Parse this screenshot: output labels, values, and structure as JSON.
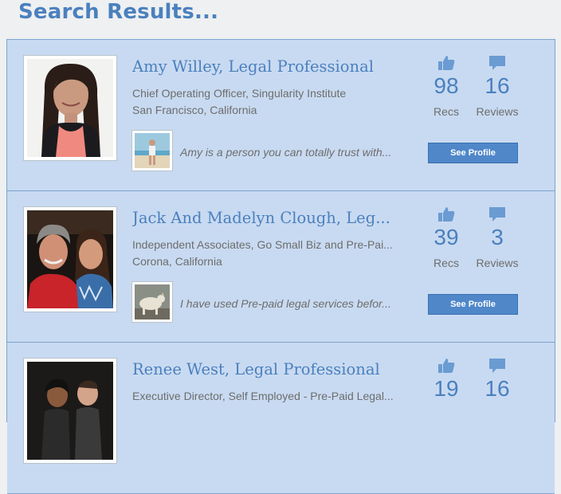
{
  "page": {
    "title": "Search Results..."
  },
  "colors": {
    "accent": "#4b80be",
    "card_bg": "#c8daf1",
    "button_bg": "#4f87c9",
    "muted_text": "#6d6d6d"
  },
  "results": [
    {
      "name": "Amy Willey, Legal Professional",
      "role": "Chief Operating Officer, Singularity Institute",
      "location": "San Francisco, California",
      "quote": "Amy is a person you can totally trust with...",
      "recs": "98",
      "recs_label": "Recs",
      "reviews": "16",
      "reviews_label": "Reviews",
      "button_label": "See Profile"
    },
    {
      "name": "Jack And Madelyn Clough, Leg...",
      "role": "Independent Associates, Go Small Biz and Pre-Pai...",
      "location": "Corona, California",
      "quote": "I have used Pre-paid legal services befor...",
      "recs": "39",
      "recs_label": "Recs",
      "reviews": "3",
      "reviews_label": "Reviews",
      "button_label": "See Profile"
    },
    {
      "name": "Renee West, Legal Professional",
      "role": "Executive Director, Self Employed - Pre-Paid Legal...",
      "location": "",
      "quote": "",
      "recs": "19",
      "recs_label": "",
      "reviews": "16",
      "reviews_label": "",
      "button_label": ""
    }
  ],
  "icons": {
    "recs": "thumbs-up-icon",
    "reviews": "speech-bubble-icon"
  }
}
